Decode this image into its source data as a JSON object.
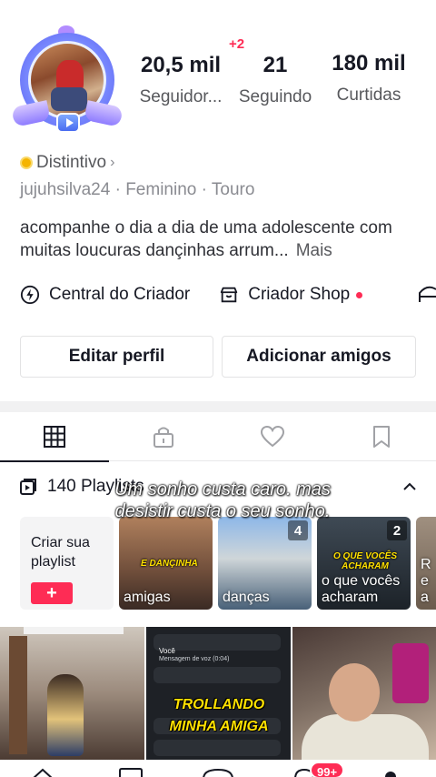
{
  "profile": {
    "username": "jujuhsilva24",
    "gender": "Feminino",
    "sign": "Touro",
    "badge_label": "Distintivo",
    "bio": "acompanhe o dia a dia de uma adolescente com muitas loucuras dançinhas arrum...",
    "bio_more": "Mais"
  },
  "stats": {
    "followers_value": "20,5 mil",
    "followers_label": "Seguidor...",
    "followers_delta": "+2",
    "following_value": "21",
    "following_label": "Seguindo",
    "likes_value": "180 mil",
    "likes_label": "Curtidas"
  },
  "creator_row": {
    "creator_center": "Central do Criador",
    "creator_shop": "Criador Shop"
  },
  "buttons": {
    "edit_profile": "Editar perfil",
    "add_friends": "Adicionar amigos"
  },
  "tabs": [
    {
      "icon": "grid-icon",
      "active": true
    },
    {
      "icon": "lock-icon",
      "active": false
    },
    {
      "icon": "heart-icon",
      "active": false
    },
    {
      "icon": "bookmark-icon",
      "active": false
    }
  ],
  "playlists": {
    "header": "140 Playlists",
    "create_label": "Criar sua playlist",
    "create_plus": "+",
    "items": [
      {
        "name": "amigas",
        "count": "",
        "sticker": "E DANÇINHA"
      },
      {
        "name": "danças",
        "count": "4",
        "sticker": ""
      },
      {
        "name": "o que vocês acharam",
        "count": "2",
        "sticker": "O QUE VOCÊS ACHARAM"
      },
      {
        "name": "Re a",
        "count": "",
        "sticker": ""
      }
    ]
  },
  "overlay_caption": "Um sonho custa caro. mas desistir custa o seu sonho.",
  "videos": [
    {
      "caption": ""
    },
    {
      "caption": "TROLLANDO MINHA AMIGA",
      "chat_header": "Você",
      "chat_line": "Mensagem de voz (0:04)"
    },
    {
      "caption": ""
    }
  ],
  "bottom_nav": {
    "inbox_badge": "99+"
  },
  "colors": {
    "accent": "#fe2c55",
    "text_primary": "#161823",
    "text_secondary": "#57585c",
    "text_muted": "#8a8b91",
    "badge_gold": "#f5b400"
  }
}
